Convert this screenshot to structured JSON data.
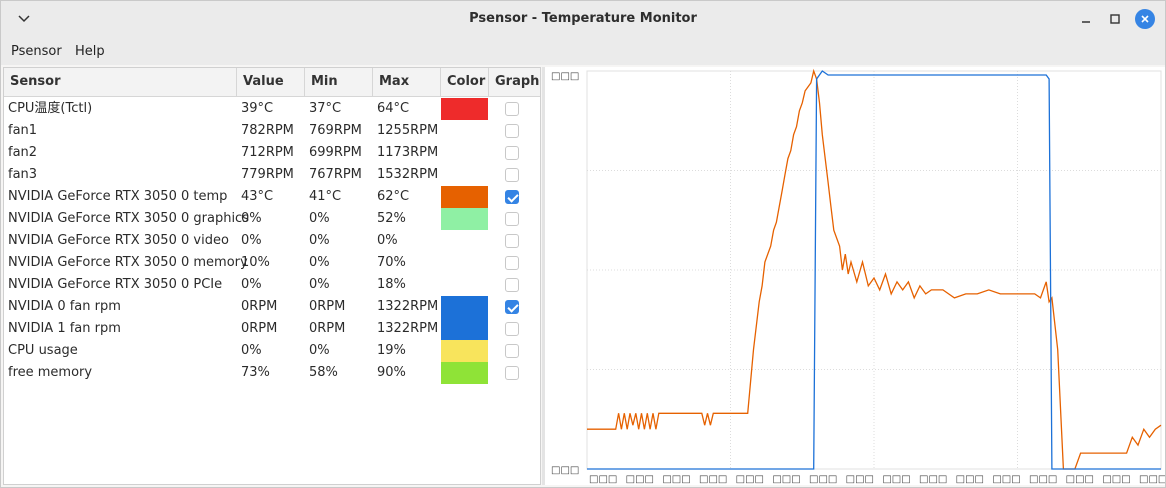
{
  "window": {
    "title": "Psensor - Temperature Monitor"
  },
  "menu": {
    "items": [
      "Psensor",
      "Help"
    ]
  },
  "table": {
    "columns": [
      "Sensor",
      "Value",
      "Min",
      "Max",
      "Color",
      "Graph"
    ],
    "rows": [
      {
        "name": "CPU温度(Tctl)",
        "value": "39°C",
        "min": "37°C",
        "max": "64°C",
        "color": "#ee2b2b",
        "graph": false
      },
      {
        "name": "fan1",
        "value": "782RPM",
        "min": "769RPM",
        "max": "1255RPM",
        "color": "",
        "graph": false
      },
      {
        "name": "fan2",
        "value": "712RPM",
        "min": "699RPM",
        "max": "1173RPM",
        "color": "",
        "graph": false
      },
      {
        "name": "fan3",
        "value": "779RPM",
        "min": "767RPM",
        "max": "1532RPM",
        "color": "",
        "graph": false
      },
      {
        "name": "NVIDIA GeForce RTX 3050 0 temp",
        "value": "43°C",
        "min": "41°C",
        "max": "62°C",
        "color": "#e66100",
        "graph": true
      },
      {
        "name": "NVIDIA GeForce RTX 3050 0 graphics",
        "value": "0%",
        "min": "0%",
        "max": "52%",
        "color": "#8ff0a4",
        "graph": false
      },
      {
        "name": "NVIDIA GeForce RTX 3050 0 video",
        "value": "0%",
        "min": "0%",
        "max": "0%",
        "color": "",
        "graph": false
      },
      {
        "name": "NVIDIA GeForce RTX 3050 0 memory",
        "value": "10%",
        "min": "0%",
        "max": "70%",
        "color": "",
        "graph": false
      },
      {
        "name": "NVIDIA GeForce RTX 3050 0 PCIe",
        "value": "0%",
        "min": "0%",
        "max": "18%",
        "color": "",
        "graph": false
      },
      {
        "name": "NVIDIA 0 fan rpm",
        "value": "0RPM",
        "min": "0RPM",
        "max": "1322RPM",
        "color": "#1c71d8",
        "graph": true
      },
      {
        "name": "NVIDIA 1 fan rpm",
        "value": "0RPM",
        "min": "0RPM",
        "max": "1322RPM",
        "color": "#1c71d8",
        "graph": false
      },
      {
        "name": "CPU usage",
        "value": "0%",
        "min": "0%",
        "max": "19%",
        "color": "#f8e45c",
        "graph": false
      },
      {
        "name": "free memory",
        "value": "73%",
        "min": "58%",
        "max": "90%",
        "color": "#8fe337",
        "graph": false
      }
    ]
  },
  "chart_data": {
    "type": "line",
    "title": "",
    "xlabel": "",
    "ylabel": "",
    "grid": true,
    "tick_labels": {
      "y_top": "□□□",
      "y_bottom": "□□□",
      "x_ticks": [
        "□□□",
        "□□□",
        "□□□",
        "□□□",
        "□□□",
        "□□□",
        "□□□",
        "□□□",
        "□□□",
        "□□□",
        "□□□",
        "□□□",
        "□□□",
        "□□□",
        "□□□",
        "□□□"
      ]
    },
    "xlim": [
      0,
      100
    ],
    "ylim": [
      0,
      100
    ],
    "series": [
      {
        "color": "#e66100",
        "x": [
          0,
          5,
          5.5,
          6,
          6.5,
          7,
          7.5,
          8,
          8.5,
          9,
          9.5,
          10,
          10.5,
          11,
          11.5,
          12,
          12.5,
          13,
          20,
          20.5,
          21,
          21.5,
          22,
          28,
          29,
          30,
          30.5,
          31,
          32,
          32.5,
          33,
          33.5,
          34,
          34.5,
          35,
          35.5,
          36,
          36.5,
          37,
          37.5,
          38,
          38.5,
          39,
          39.5,
          40,
          40.5,
          41,
          41.5,
          42,
          42.5,
          43,
          44,
          44.5,
          45,
          45.5,
          46,
          47,
          48,
          49,
          50,
          51,
          52,
          53,
          54,
          55,
          56,
          57,
          58,
          59,
          60,
          62,
          64,
          66,
          68,
          70,
          72,
          74,
          76,
          78,
          79,
          80,
          80.5,
          81,
          82,
          83,
          84,
          85,
          86,
          87,
          88,
          89,
          90,
          91,
          92,
          93,
          94,
          95,
          96,
          97,
          98,
          99,
          100
        ],
        "values": [
          10,
          10,
          14,
          10,
          14,
          10,
          14,
          11,
          14,
          10,
          14,
          10,
          14,
          10,
          14,
          10,
          14,
          14,
          14,
          11,
          14,
          11,
          14,
          14,
          30,
          42,
          46,
          52,
          56,
          60,
          62,
          66,
          70,
          74,
          78,
          80,
          84,
          86,
          90,
          92,
          95,
          96,
          97,
          100,
          98,
          92,
          84,
          78,
          72,
          66,
          60,
          56,
          50,
          54,
          49,
          52,
          47,
          52,
          46,
          48,
          45,
          49,
          44,
          47,
          45,
          47,
          43,
          46,
          44,
          45,
          45,
          43,
          44,
          44,
          45,
          44,
          44,
          44,
          44,
          43,
          47,
          42,
          43,
          30,
          0,
          0,
          0,
          4,
          4,
          4,
          4,
          4,
          4,
          4,
          4,
          4,
          8,
          6,
          10,
          8,
          10,
          11
        ],
        "name": ""
      },
      {
        "color": "#1c71d8",
        "x": [
          0,
          38,
          39.5,
          40,
          41,
          42,
          50,
          60,
          70,
          80,
          80.5,
          81,
          90,
          100
        ],
        "values": [
          0,
          0,
          0,
          98,
          100,
          99,
          99,
          99,
          99,
          99,
          98,
          0,
          0,
          0
        ],
        "name": ""
      }
    ]
  }
}
